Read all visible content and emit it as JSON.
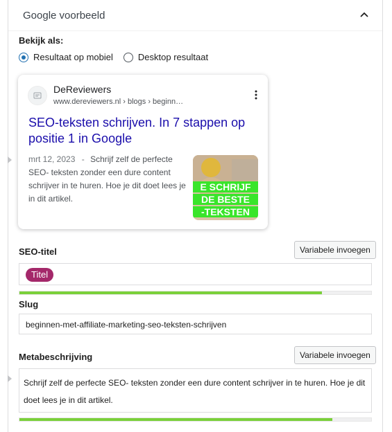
{
  "panel": {
    "title": "Google voorbeeld"
  },
  "view": {
    "label": "Bekijk als:",
    "options": [
      {
        "label": "Resultaat op mobiel",
        "selected": true
      },
      {
        "label": "Desktop resultaat",
        "selected": false
      }
    ]
  },
  "serp": {
    "site_name": "DeReviewers",
    "url": "www.dereviewers.nl › blogs › beginn…",
    "title": "SEO-teksten schrijven. In 7 stappen op positie 1 in Google",
    "date": "mrt 12, 2023",
    "separator": "-",
    "description": "Schrijf zelf de perfecte SEO- teksten zonder een dure content schrijver in te huren. Hoe je dit doet lees je in dit artikel.",
    "thumbnail_lines": [
      "E SCHRIJF",
      "DE BESTE",
      "-TEKSTEN"
    ]
  },
  "seo_title": {
    "label": "SEO-titel",
    "button": "Variabele invoegen",
    "pill": "Titel",
    "progress": 0.86
  },
  "slug": {
    "label": "Slug",
    "value": "beginnen-met-affiliate-marketing-seo-teksten-schrijven"
  },
  "meta": {
    "label": "Metabeschrijving",
    "button": "Variabele invoegen",
    "value": "Schrijf zelf de perfecte SEO- teksten zonder een dure content schrijver in te huren. Hoe je dit doet lees je in dit artikel.",
    "progress": 0.89
  },
  "colors": {
    "progress_good": "#7ad03a",
    "pill": "#a4286a",
    "link": "#1a0dab",
    "radio": "#2271b1"
  }
}
